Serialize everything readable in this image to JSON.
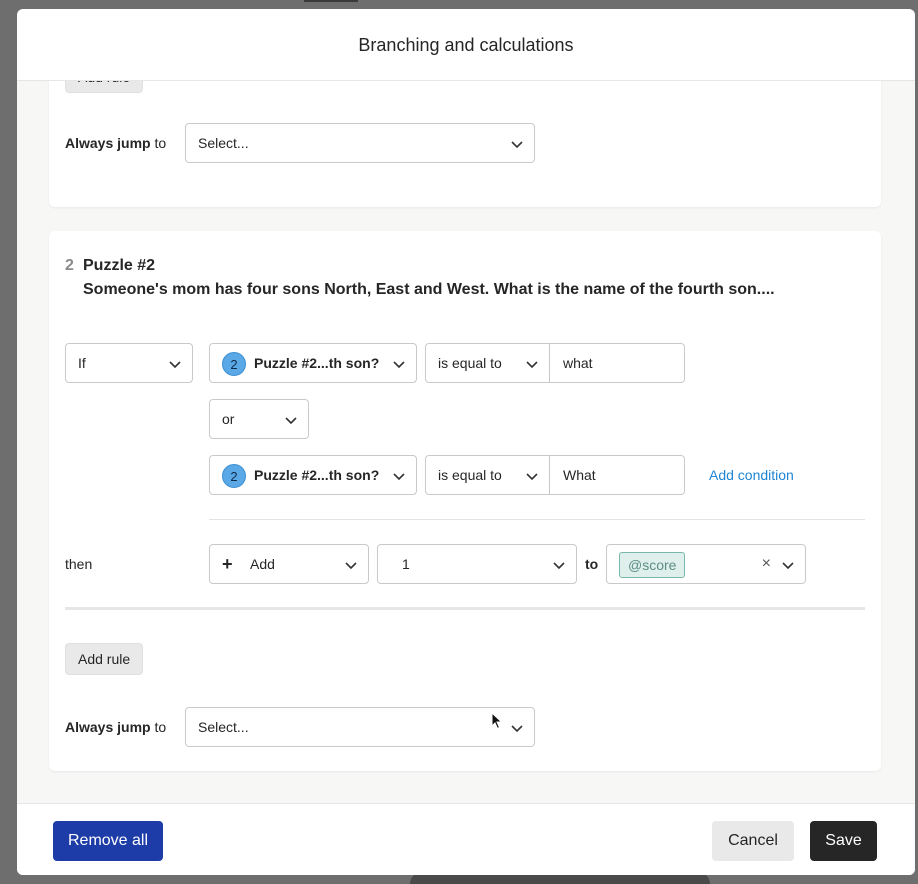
{
  "modal": {
    "title": "Branching and calculations"
  },
  "card1": {
    "add_rule_label": "Add rule",
    "always_jump_bold": "Always jump",
    "always_jump_to": "to",
    "jump_select_value": "Select..."
  },
  "card2": {
    "question_number": "2",
    "question_title": "Puzzle #2",
    "question_text": "Someone's mom has four sons North, East and West. What is the name of the fourth son....",
    "logic_operator": "If",
    "condition1": {
      "badge": "2",
      "question": "Puzzle #2...th son?",
      "comparator": "is equal to",
      "value": "what"
    },
    "join_operator": "or",
    "condition2": {
      "badge": "2",
      "question": "Puzzle #2...th son?",
      "comparator": "is equal to",
      "value": "What"
    },
    "add_condition_label": "Add condition",
    "then_label": "then",
    "action": {
      "plus_icon": "+",
      "operation": "Add",
      "amount": "1",
      "to_label": "to",
      "variable": "@score",
      "clear_icon": "×"
    },
    "add_rule_label": "Add rule",
    "always_jump_bold": "Always jump",
    "always_jump_to": "to",
    "jump_select_value": "Select..."
  },
  "footer": {
    "remove_all_label": "Remove all",
    "cancel_label": "Cancel",
    "save_label": "Save"
  },
  "colors": {
    "primary": "#1d3ca8",
    "link": "#1e86d4",
    "badge": "#5aa9e6",
    "tag_bg": "#dff0ec",
    "tag_border": "#7ab7ab"
  }
}
